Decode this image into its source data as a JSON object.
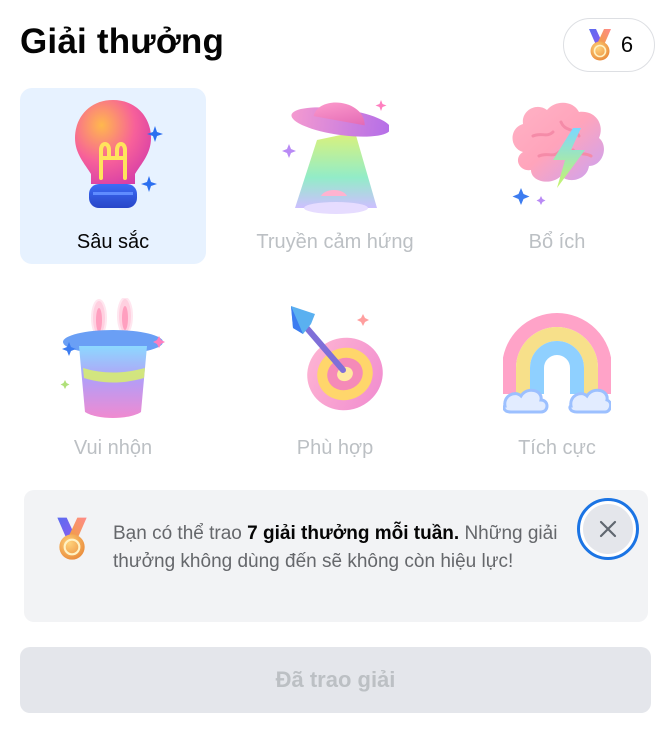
{
  "header": {
    "title": "Giải thưởng",
    "counter": {
      "icon": "medal-icon",
      "value": "6"
    }
  },
  "awards": [
    {
      "label": "Sâu sắc",
      "icon": "lightbulb-icon",
      "selected": true
    },
    {
      "label": "Truyền cảm hứng",
      "icon": "ufo-icon",
      "selected": false
    },
    {
      "label": "Bổ ích",
      "icon": "brain-lightning-icon",
      "selected": false
    },
    {
      "label": "Vui nhộn",
      "icon": "magic-hat-bunny-icon",
      "selected": false
    },
    {
      "label": "Phù hợp",
      "icon": "dart-target-icon",
      "selected": false
    },
    {
      "label": "Tích cực",
      "icon": "rainbow-icon",
      "selected": false
    }
  ],
  "info": {
    "icon": "medal-icon",
    "text_prefix": "Bạn có thể trao ",
    "text_bold": "7 giải thưởng mỗi tuần.",
    "text_rest": "Những giải thưởng không dùng đến sẽ không còn hiệu lực!",
    "close_icon": "close-icon"
  },
  "action": {
    "label": "Đã trao giải",
    "enabled": false
  },
  "colors": {
    "selected_bg": "#e7f2ff",
    "focus_ring": "#1b74e4",
    "disabled_text": "#bcc0c4"
  }
}
